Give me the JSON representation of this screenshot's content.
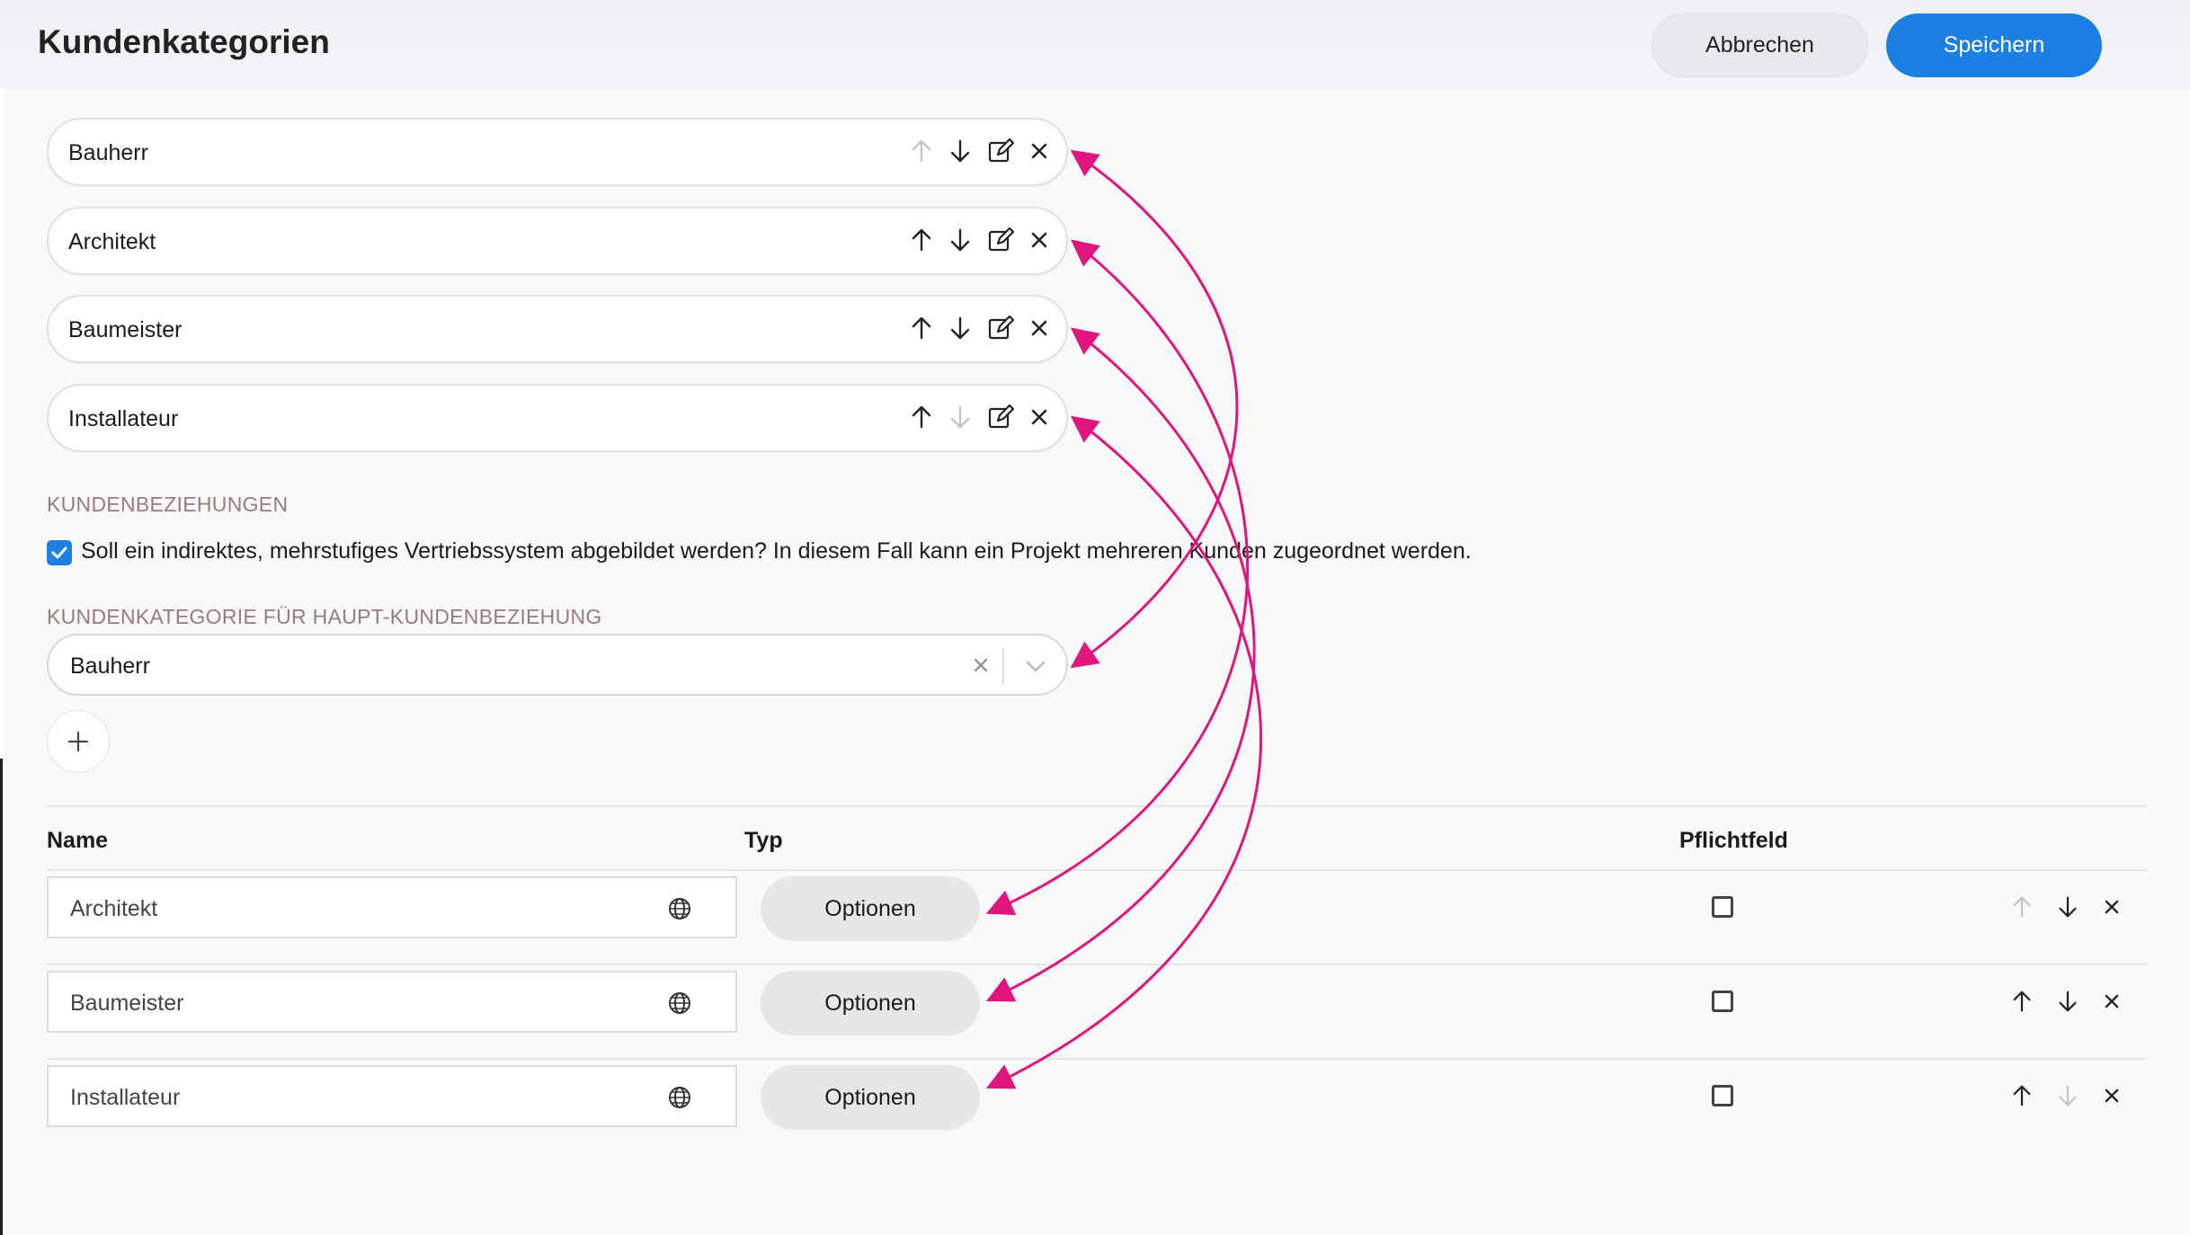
{
  "header": {
    "title": "Kundenkategorien",
    "cancel_label": "Abbrechen",
    "save_label": "Speichern"
  },
  "categories": [
    {
      "label": "Bauherr",
      "up_enabled": false,
      "down_enabled": true
    },
    {
      "label": "Architekt",
      "up_enabled": true,
      "down_enabled": true
    },
    {
      "label": "Baumeister",
      "up_enabled": true,
      "down_enabled": true
    },
    {
      "label": "Installateur",
      "up_enabled": true,
      "down_enabled": false
    }
  ],
  "relations": {
    "section_title": "KUNDENBEZIEHUNGEN",
    "checkbox_checked": true,
    "checkbox_label": "Soll ein indirektes, mehrstufiges Vertriebssystem abgebildet werden? In diesem Fall kann ein Projekt mehreren Kunden zugeordnet werden.",
    "main_category_label": "KUNDENKATEGORIE FÜR HAUPT-KUNDENBEZIEHUNG",
    "main_category_value": "Bauherr"
  },
  "table": {
    "headers": {
      "name": "Name",
      "type": "Typ",
      "required": "Pflichtfeld"
    },
    "rows": [
      {
        "name": "Architekt",
        "type_button": "Optionen",
        "required": false,
        "up_enabled": false,
        "down_enabled": true
      },
      {
        "name": "Baumeister",
        "type_button": "Optionen",
        "required": false,
        "up_enabled": true,
        "down_enabled": true
      },
      {
        "name": "Installateur",
        "type_button": "Optionen",
        "required": false,
        "up_enabled": true,
        "down_enabled": false
      }
    ]
  },
  "colors": {
    "accent": "#1c7fe3",
    "annotation": "#e0157e",
    "disabled_icon": "#c4c4c4",
    "section_label": "#9a7a7a"
  },
  "icons": [
    "arrow-up-icon",
    "arrow-down-icon",
    "edit-icon",
    "close-icon",
    "checkmark-icon",
    "clear-icon",
    "chevron-down-icon",
    "plus-icon",
    "globe-icon"
  ]
}
